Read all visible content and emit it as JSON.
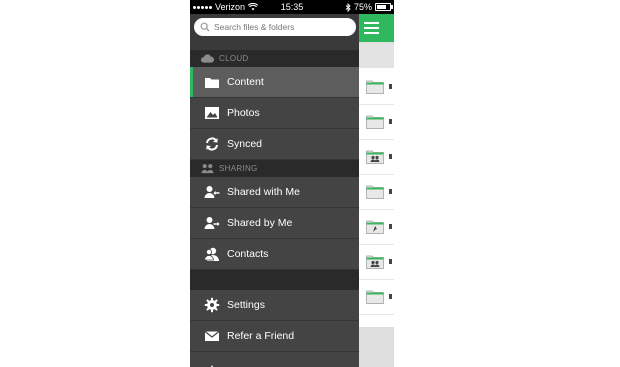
{
  "status_bar": {
    "carrier": "Verizon",
    "time": "15:35",
    "battery": "75%"
  },
  "search": {
    "placeholder": "Search files & folders"
  },
  "sections": {
    "cloud": {
      "header": "CLOUD",
      "items": [
        {
          "label": "Content",
          "icon": "folder-icon",
          "active": true
        },
        {
          "label": "Photos",
          "icon": "photo-icon"
        },
        {
          "label": "Synced",
          "icon": "sync-icon"
        }
      ]
    },
    "sharing": {
      "header": "SHARING",
      "items": [
        {
          "label": "Shared with Me",
          "icon": "user-incoming-icon"
        },
        {
          "label": "Shared by Me",
          "icon": "user-outgoing-icon"
        },
        {
          "label": "Contacts",
          "icon": "contacts-icon"
        }
      ]
    },
    "bottom": {
      "items": [
        {
          "label": "Settings",
          "icon": "gear-icon"
        },
        {
          "label": "Refer a Friend",
          "icon": "envelope-icon"
        }
      ]
    }
  },
  "file_rows": [
    {
      "icon": "folder-icon"
    },
    {
      "icon": "folder-icon"
    },
    {
      "icon": "shared-folder-icon"
    },
    {
      "icon": "folder-icon"
    },
    {
      "icon": "special-folder-icon"
    },
    {
      "icon": "shared-folder-icon"
    },
    {
      "icon": "folder-icon"
    }
  ],
  "colors": {
    "accent": "#2fb85e",
    "menu_bg": "#444444",
    "menu_active": "#5d5d5d",
    "section_header_bg": "#2a2a2a"
  }
}
